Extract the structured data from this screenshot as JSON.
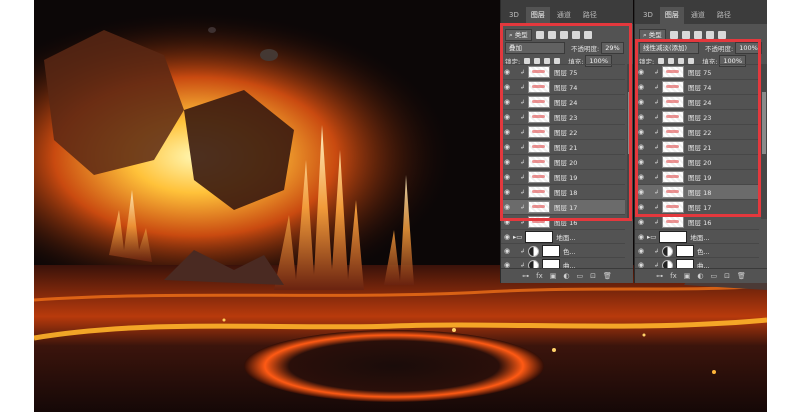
{
  "tabs": [
    "3D",
    "图层",
    "通道",
    "路径"
  ],
  "left_panel": {
    "filter_label": "类型",
    "blend_mode": "叠加",
    "opacity_label": "不透明度:",
    "opacity_value": "29%",
    "lock_label": "锁定:",
    "fill_label": "填充:",
    "fill_value": "100%",
    "layers": [
      {
        "name": "图层 75"
      },
      {
        "name": "图层 74"
      },
      {
        "name": "图层 24"
      },
      {
        "name": "图层 23"
      },
      {
        "name": "图层 22"
      },
      {
        "name": "图层 21"
      },
      {
        "name": "图层 20"
      },
      {
        "name": "图层 19"
      },
      {
        "name": "图层 18"
      },
      {
        "name": "图层 17"
      },
      {
        "name": "图层 16"
      }
    ],
    "group_name": "地面...",
    "adjustments": [
      "色...",
      "曲..."
    ]
  },
  "right_panel": {
    "filter_label": "类型",
    "blend_mode": "线性减淡(添加)",
    "opacity_label": "不透明度:",
    "opacity_value": "100%",
    "lock_label": "锁定:",
    "fill_label": "填充:",
    "fill_value": "100%",
    "layers": [
      {
        "name": "图层 75"
      },
      {
        "name": "图层 74"
      },
      {
        "name": "图层 24"
      },
      {
        "name": "图层 23"
      },
      {
        "name": "图层 22"
      },
      {
        "name": "图层 21"
      },
      {
        "name": "图层 20"
      },
      {
        "name": "图层 19"
      },
      {
        "name": "图层 18"
      },
      {
        "name": "图层 17"
      },
      {
        "name": "图层 16"
      }
    ],
    "group_name": "地面...",
    "adjustments": [
      "色...",
      "曲..."
    ]
  },
  "footer_icons": [
    "link-icon",
    "fx-icon",
    "mask-icon",
    "adjustment-icon",
    "folder-icon",
    "new-layer-icon",
    "trash-icon"
  ],
  "colors": {
    "highlight": "#e4383d",
    "panel_bg": "#535353",
    "tabbar_bg": "#3c3c3c"
  }
}
